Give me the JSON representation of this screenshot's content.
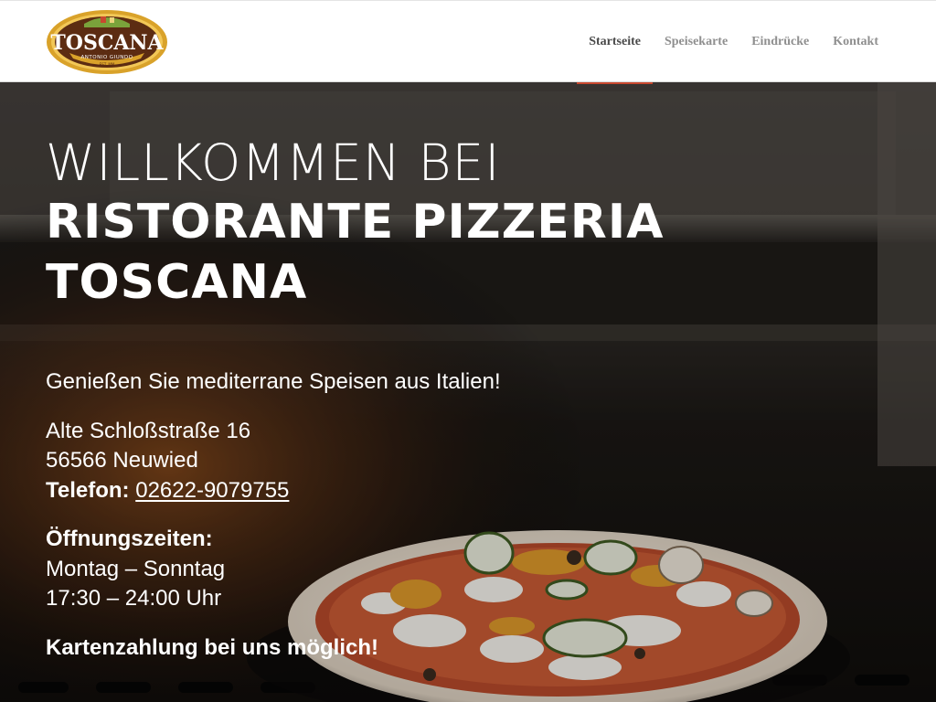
{
  "logo": {
    "name": "TOSCANA",
    "subtitle": "ANTONIO GIUNDO",
    "est": "EST. MM",
    "colors": {
      "frame": "#d9a22a",
      "field": "#5c2c12",
      "text": "#ffffff"
    }
  },
  "nav": {
    "items": [
      {
        "label": "Startseite",
        "active": true
      },
      {
        "label": "Speisekarte",
        "active": false
      },
      {
        "label": "Eindrücke",
        "active": false
      },
      {
        "label": "Kontakt",
        "active": false
      }
    ],
    "active_underline_color": "#c8482f"
  },
  "hero": {
    "welcome": "WILLKOMMEN BEI",
    "title_line1": "RISTORANTE PIZZERIA",
    "title_line2": "TOSCANA",
    "tagline": "Genießen Sie mediterrane Speisen aus Italien!",
    "address_street": "Alte Schloßstraße 16",
    "address_city": "56566 Neuwied",
    "phone_label": "Telefon:",
    "phone_number": "02622-9079755",
    "hours_label": "Öffnungszeiten:",
    "hours_days": "Montag – Sonntag",
    "hours_time": "17:30 – 24:00 Uhr",
    "payment_note": "Kartenzahlung bei uns möglich!"
  }
}
